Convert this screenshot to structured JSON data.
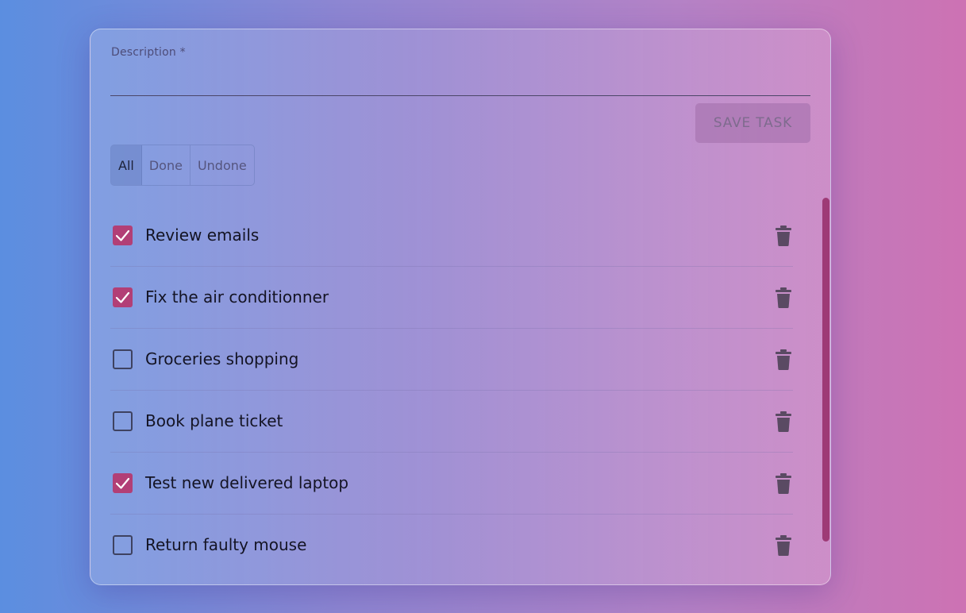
{
  "form": {
    "description_label": "Description *",
    "description_value": "",
    "save_label": "SAVE TASK"
  },
  "filters": [
    {
      "label": "All",
      "active": true
    },
    {
      "label": "Done",
      "active": false
    },
    {
      "label": "Undone",
      "active": false
    }
  ],
  "tasks": [
    {
      "text": "Review emails",
      "done": true
    },
    {
      "text": "Fix the air conditionner",
      "done": true
    },
    {
      "text": "Groceries shopping",
      "done": false
    },
    {
      "text": "Book plane ticket",
      "done": false
    },
    {
      "text": "Test new delivered laptop",
      "done": true
    },
    {
      "text": "Return faulty mouse",
      "done": false
    }
  ],
  "icons": {
    "check": "check-icon",
    "delete": "trash-icon"
  },
  "colors": {
    "accent": "#b23f76",
    "scrollbar": "#9e3a76",
    "trash": "#5a4a63"
  }
}
